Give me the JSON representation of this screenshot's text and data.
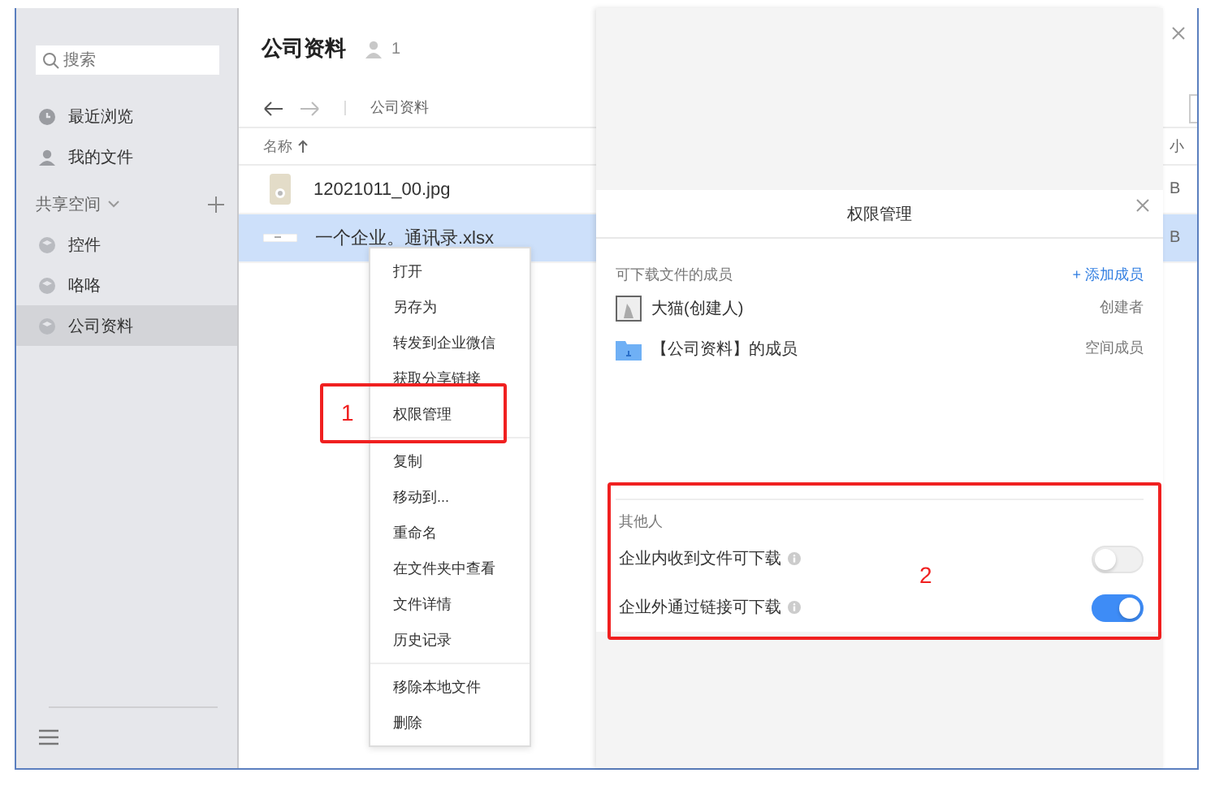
{
  "sidebar": {
    "search": {
      "placeholder": "搜索"
    },
    "items": [
      {
        "label": "最近浏览",
        "kind": "recent",
        "selected": false
      },
      {
        "label": "我的文件",
        "kind": "mine",
        "selected": false
      }
    ],
    "section": {
      "label": "共享空间"
    },
    "spaces": [
      {
        "label": "控件",
        "selected": false
      },
      {
        "label": "咯咯",
        "selected": false
      },
      {
        "label": "公司资料",
        "selected": true
      }
    ]
  },
  "folder": {
    "title": "公司资料",
    "member_count": "1",
    "breadcrumb": "公司资料"
  },
  "table": {
    "columns": [
      {
        "label": "名称",
        "sorted": true
      },
      {
        "label": "小",
        "sorted": false
      }
    ],
    "rows": [
      {
        "name": "12021011_00.jpg",
        "kind": "image",
        "size": "B",
        "selected": false
      },
      {
        "name": "一个企业。通讯录.xlsx",
        "kind": "sheet",
        "size": "B",
        "selected": true
      }
    ]
  },
  "context_menu": {
    "groups": [
      [
        "打开",
        "另存为",
        "转发到企业微信",
        "获取分享链接",
        "权限管理"
      ],
      [
        "复制",
        "移动到...",
        "重命名",
        "在文件夹中查看",
        "文件详情",
        "历史记录"
      ],
      [
        "移除本地文件",
        "删除"
      ]
    ]
  },
  "dialog": {
    "title": "权限管理",
    "members_label": "可下载文件的成员",
    "add_label": "+ 添加成员",
    "members": [
      {
        "name": "大猫(创建人)",
        "kind": "person",
        "role": "创建者"
      },
      {
        "name": "【公司资料】的成员",
        "kind": "space",
        "role": "空间成员"
      }
    ],
    "others_label": "其他人",
    "others": [
      {
        "label": "企业内收到文件可下载",
        "on": false
      },
      {
        "label": "企业外通过链接可下载",
        "on": true
      }
    ]
  },
  "annotations": [
    {
      "label": "1"
    },
    {
      "label": "2"
    }
  ]
}
